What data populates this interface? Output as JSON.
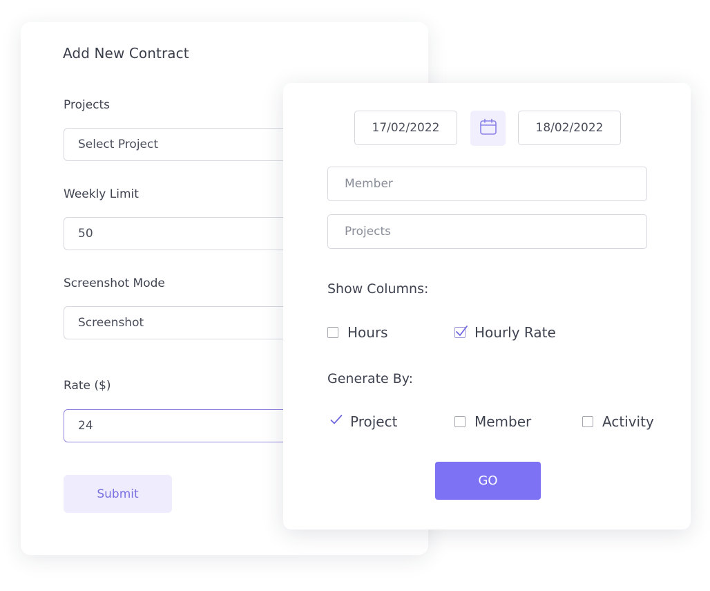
{
  "contract_form": {
    "title": "Add New Contract",
    "projects_label": "Projects",
    "projects_value": "Select Project",
    "weekly_limit_label": "Weekly Limit",
    "weekly_limit_value": "50",
    "screenshot_mode_label": "Screenshot Mode",
    "screenshot_mode_value": "Screenshot",
    "rate_label": "Rate ($)",
    "rate_value": "24",
    "submit_label": "Submit"
  },
  "report_form": {
    "start_date": "17/02/2022",
    "end_date": "18/02/2022",
    "calendar_icon": "calendar-icon",
    "member_placeholder": "Member",
    "projects_placeholder": "Projects",
    "show_columns_label": "Show Columns:",
    "columns": [
      {
        "label": "Hours",
        "checked": false
      },
      {
        "label": "Hourly Rate",
        "checked": true
      }
    ],
    "generate_by_label": "Generate By:",
    "generate_by": [
      {
        "label": "Project",
        "checked": true
      },
      {
        "label": "Member",
        "checked": false
      },
      {
        "label": "Activity",
        "checked": false
      }
    ],
    "go_label": "GO"
  },
  "colors": {
    "accent": "#7c72f3",
    "accent_light": "#efedfd",
    "border": "#d6d8de",
    "text": "#3f4350"
  }
}
